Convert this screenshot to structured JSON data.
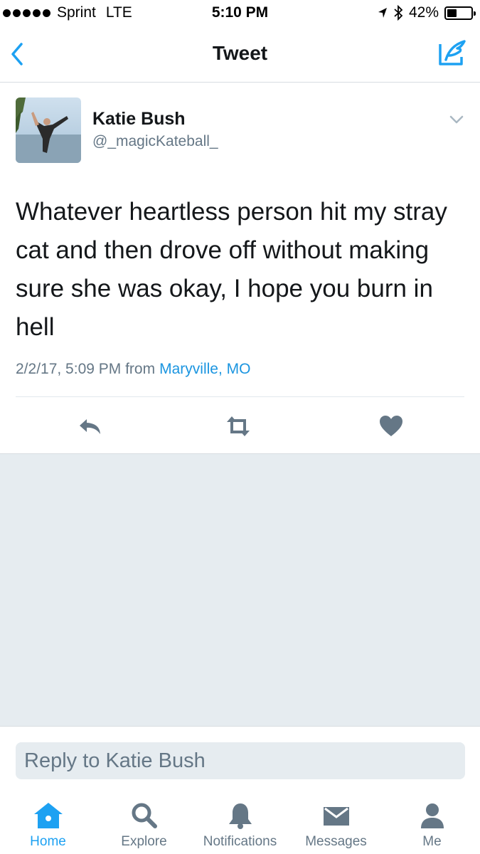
{
  "status_bar": {
    "carrier": "Sprint",
    "network": "LTE",
    "time": "5:10 PM",
    "battery": "42%",
    "battery_level": 0.42,
    "signal_icon": "signal-dots-icon",
    "location_icon": "location-arrow-icon",
    "bluetooth_icon": "bluetooth-icon"
  },
  "nav": {
    "title": "Tweet",
    "back_icon": "chevron-left-icon",
    "compose_icon": "compose-tweet-icon"
  },
  "tweet": {
    "name": "Katie Bush",
    "handle": "@_magicKateball_",
    "text": "Whatever heartless person hit my stray cat and then drove off without making sure she was okay, I hope you burn in hell",
    "timestamp": "2/2/17, 5:09 PM from",
    "location": "Maryville, MO",
    "actions": [
      "reply-icon",
      "retweet-icon",
      "like-icon"
    ]
  },
  "reply": {
    "placeholder": "Reply to Katie Bush"
  },
  "tabs": [
    {
      "label": "Home",
      "icon": "home-icon",
      "active": true
    },
    {
      "label": "Explore",
      "icon": "search-icon",
      "active": false
    },
    {
      "label": "Notifications",
      "icon": "bell-icon",
      "active": false
    },
    {
      "label": "Messages",
      "icon": "envelope-icon",
      "active": false
    },
    {
      "label": "Me",
      "icon": "person-icon",
      "active": false
    }
  ],
  "colors": {
    "accent": "#1da1f2",
    "link": "#1b95e0",
    "secondary_text": "#657786",
    "icon_gray": "#657786",
    "background_gray": "#e6ecf0"
  }
}
